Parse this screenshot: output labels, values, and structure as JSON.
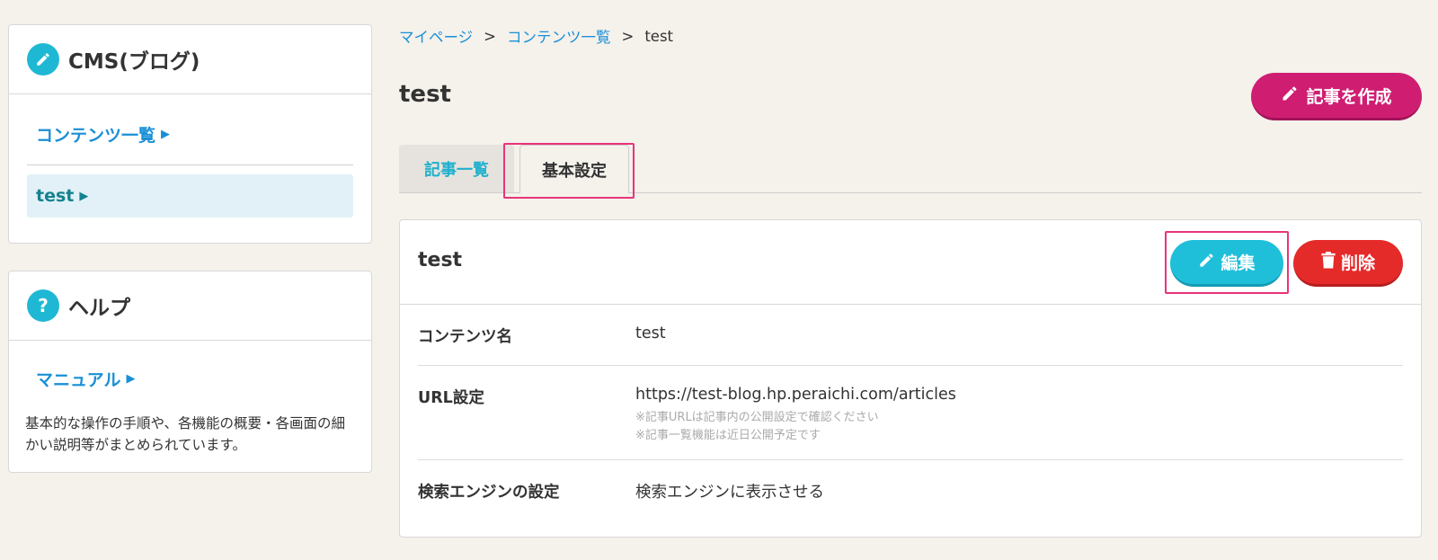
{
  "sidebar": {
    "cms": {
      "title": "CMS(ブログ)",
      "items": [
        {
          "label": "コンテンツ一覧"
        },
        {
          "label": "test"
        }
      ]
    },
    "help": {
      "title": "ヘルプ",
      "manual_label": "マニュアル",
      "description": "基本的な操作の手順や、各機能の概要・各画面の細かい説明等がまとめられています。"
    }
  },
  "breadcrumb": {
    "mypage": "マイページ",
    "contents": "コンテンツ一覧",
    "current": "test",
    "separator": ">"
  },
  "page": {
    "title": "test",
    "create_label": "記事を作成"
  },
  "tabs": [
    {
      "label": "記事一覧"
    },
    {
      "label": "基本設定"
    }
  ],
  "content": {
    "title": "test",
    "edit_label": "編集",
    "delete_label": "削除",
    "rows": [
      {
        "label": "コンテンツ名",
        "value": "test"
      },
      {
        "label": "URL設定",
        "value": "https://test-blog.hp.peraichi.com/articles",
        "notes": [
          "※記事URLは記事内の公開設定で確認ください",
          "※記事一覧機能は近日公開予定です"
        ]
      },
      {
        "label": "検索エンジンの設定",
        "value": "検索エンジンに表示させる"
      }
    ]
  },
  "colors": {
    "accent": "#1fb8d4",
    "create": "#cf1e72",
    "delete": "#e52a2a",
    "highlight": "#e8347a",
    "link": "#1a8fd6"
  }
}
